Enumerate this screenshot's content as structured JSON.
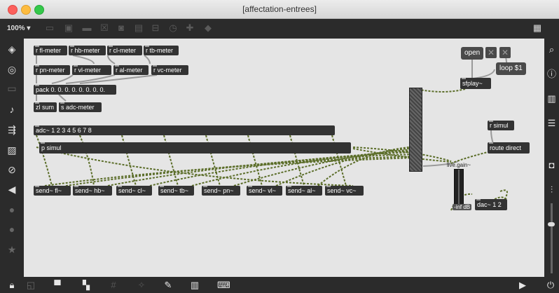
{
  "window": {
    "title": "[affectation-entrees]"
  },
  "toolbar": {
    "zoom": "100% ▾"
  },
  "objects": {
    "r_fl": "r fl-meter",
    "r_hb": "r hb-meter",
    "r_cl": "r cl-meter",
    "r_tb": "r tb-meter",
    "r_pn": "r pn-meter",
    "r_vl": "r vl-meter",
    "r_al": "r al-meter",
    "r_vc": "r vc-meter",
    "pack": "pack 0. 0. 0. 0. 0. 0. 0. 0.",
    "zl_sum": "zl sum",
    "s_adc": "s adc-meter",
    "adc": "adc~ 1 2 3 4 5 6 7 8",
    "p_simul": "p simul",
    "send_fl": "send~ fl~",
    "send_hb": "send~ hb~",
    "send_cl": "send~ cl~",
    "send_tb": "send~ tb~",
    "send_pn": "send~ pn~",
    "send_vl": "send~ vl~",
    "send_al": "send~ al~",
    "send_vc": "send~ vc~",
    "open": "open",
    "loop": "loop $1",
    "sfplay": "sfplay~",
    "r_simul": "r simul",
    "route": "route direct",
    "gain_label": "live.gain~",
    "gain_value": "-inf dB",
    "dac": "dac~ 1 2"
  },
  "icons": {
    "toolbar": [
      "presentation-icon",
      "object-icon",
      "comment-icon",
      "toggle-icon",
      "dial-icon",
      "button-icon",
      "slider-icon",
      "help-icon",
      "plus-icon",
      "paint-icon",
      "grid-icon"
    ],
    "left": [
      "packages-icon",
      "target-icon",
      "film-icon",
      "note-icon",
      "route-icon",
      "image-icon",
      "clip-icon",
      "back-icon",
      "p-icon",
      "b-icon",
      "star-icon"
    ],
    "right": [
      "search-icon",
      "info-icon",
      "book-icon",
      "list-icon",
      "camera-icon",
      "mixer-icon"
    ],
    "bottom": [
      "lock-icon",
      "presentation-icon",
      "comment-icon",
      "window-icon",
      "grid-icon",
      "wand-icon",
      "wrench-icon",
      "piano-icon",
      "keyboard-icon",
      "play-icon",
      "power-icon"
    ]
  }
}
